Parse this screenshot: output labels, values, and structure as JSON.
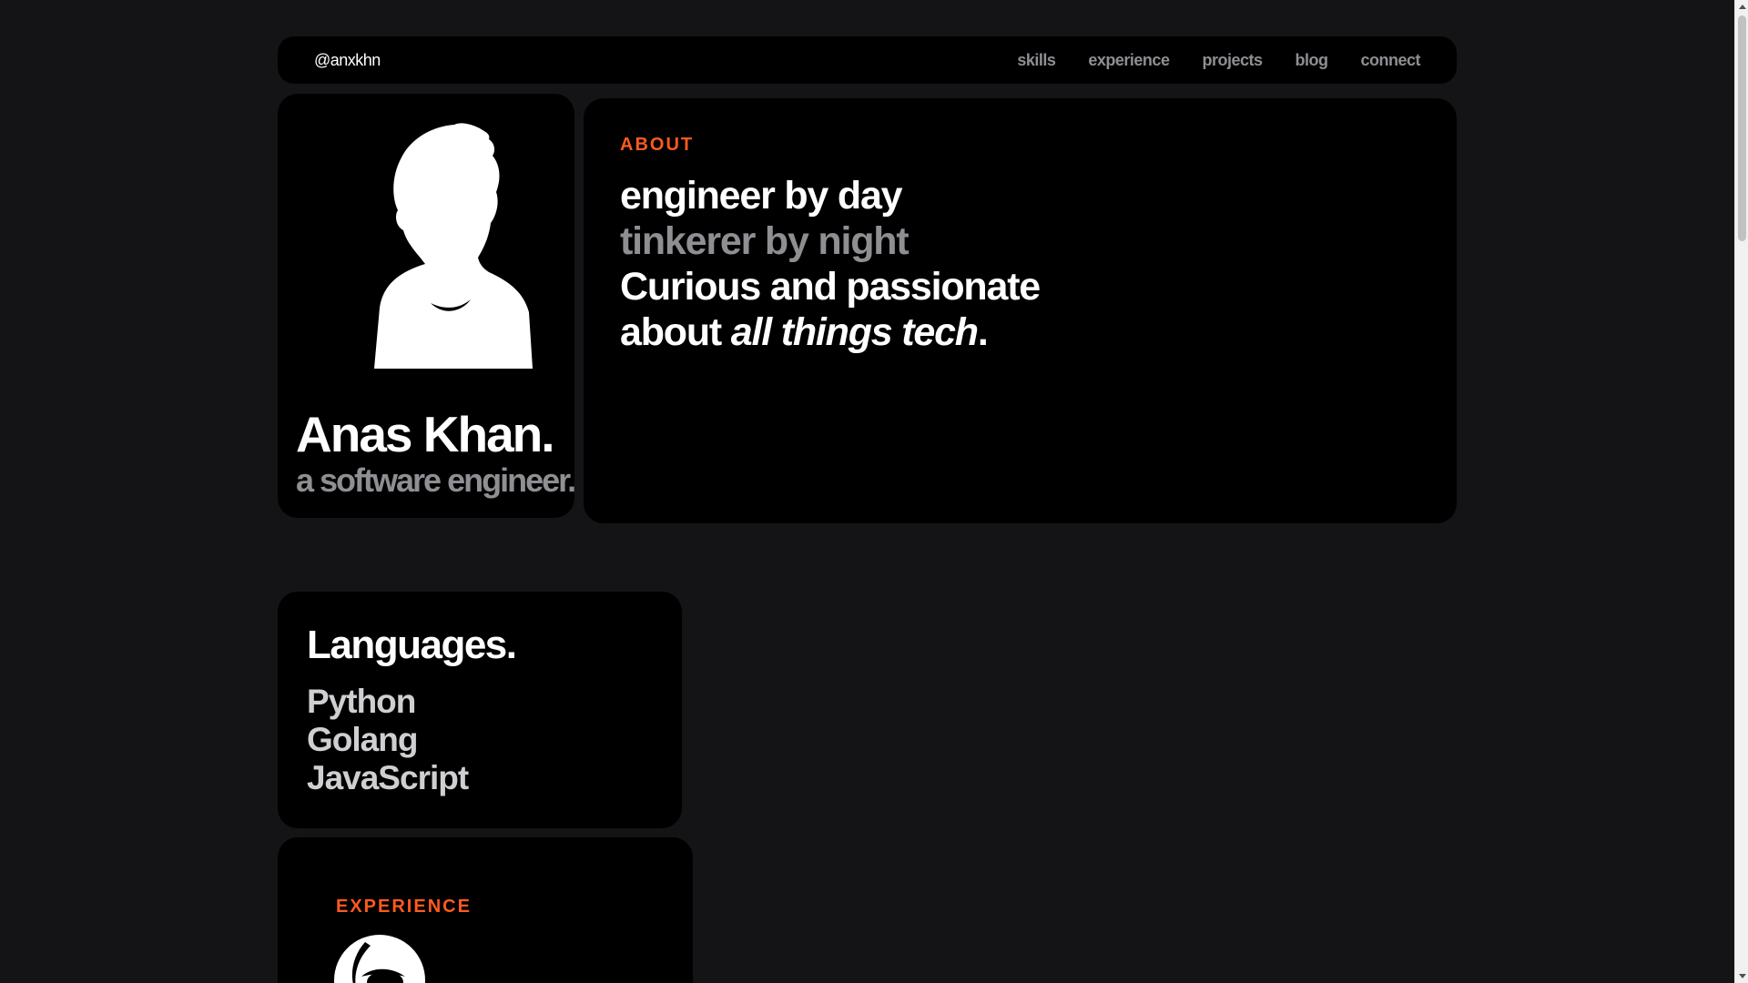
{
  "nav": {
    "handle": "@anxkhn",
    "links": [
      "skills",
      "experience",
      "projects",
      "blog",
      "connect"
    ]
  },
  "profile": {
    "avatar_icon": "person-silhouette-icon",
    "name": "Anas Khan.",
    "role": "a software engineer."
  },
  "about": {
    "label": "ABOUT",
    "line1": "engineer by day",
    "line2": "tinkerer by night",
    "line3": "Curious and passionate",
    "line4_prefix": "about ",
    "line4_emphasis": "all things tech",
    "line4_suffix": "."
  },
  "languages": {
    "title": "Languages.",
    "items": [
      "Python",
      "Golang",
      "JavaScript"
    ]
  },
  "experience": {
    "label": "EXPERIENCE",
    "logo_icon": "company-logo-icon"
  },
  "colors": {
    "background": "#141416",
    "card": "#000000",
    "accent": "#ff5a1f",
    "muted": "#8e8e93"
  }
}
